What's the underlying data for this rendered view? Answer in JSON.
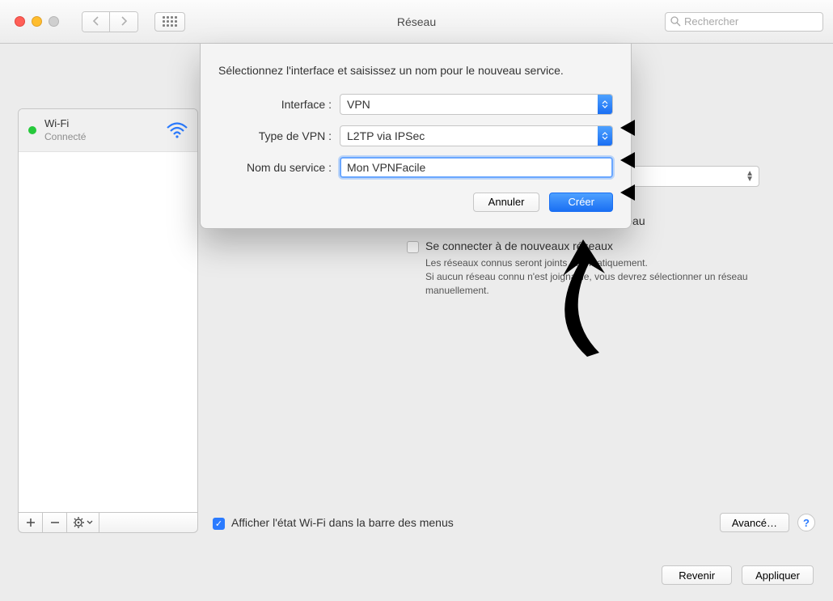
{
  "window": {
    "title": "Réseau",
    "search_placeholder": "Rechercher"
  },
  "sidebar": {
    "items": [
      {
        "name": "Wi-Fi",
        "status": "Connecté"
      }
    ],
    "toolbar": {
      "add": "+",
      "remove": "−",
      "options": "⚙︎"
    }
  },
  "content": {
    "auto_connect_label": "Se connecter automatiquement à ce réseau",
    "new_networks_label": "Se connecter à de nouveaux réseaux",
    "new_networks_help": "Les réseaux connus seront joints automatiquement.\nSi aucun réseau connu n'est joignable, vous devrez sélectionner un réseau manuellement.",
    "show_status_label": "Afficher l'état Wi-Fi dans la barre des menus",
    "advanced_button": "Avancé…",
    "revert_button": "Revenir",
    "apply_button": "Appliquer"
  },
  "sheet": {
    "prompt": "Sélectionnez l'interface et saisissez un nom pour le nouveau service.",
    "interface_label": "Interface :",
    "interface_value": "VPN",
    "vpn_type_label": "Type de VPN :",
    "vpn_type_value": "L2TP via IPSec",
    "service_name_label": "Nom du service :",
    "service_name_value": "Mon VPNFacile",
    "cancel": "Annuler",
    "create": "Créer"
  }
}
